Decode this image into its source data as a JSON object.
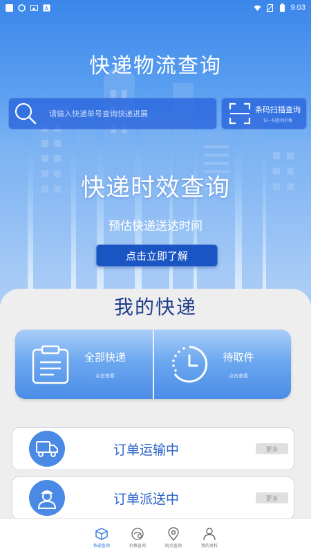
{
  "status_bar": {
    "time": "9:03"
  },
  "header": {
    "title": "快递物流查询"
  },
  "search": {
    "placeholder": "请输入快递单号查询快递进展"
  },
  "scan": {
    "label": "条码扫描查询",
    "sub": "扫一扫查询价格"
  },
  "banner": {
    "title": "快递时效查询",
    "subtitle": "预估快递送达时间",
    "button": "点击立即了解"
  },
  "my_express": {
    "title": "我的快递",
    "tiles": [
      {
        "label": "全部快递",
        "sub": "点击查看",
        "icon": "clipboard-icon"
      },
      {
        "label": "待取件",
        "sub": "点击查看",
        "icon": "clock-icon"
      }
    ],
    "orders": [
      {
        "label": "订单运输中",
        "more": "更多",
        "icon": "truck-icon"
      },
      {
        "label": "订单派送中",
        "more": "更多",
        "icon": "courier-icon"
      }
    ]
  },
  "nav": {
    "items": [
      {
        "label": "快递查询",
        "icon": "package-icon",
        "active": true
      },
      {
        "label": "价格查询",
        "icon": "price-search-icon",
        "active": false
      },
      {
        "label": "网点查询",
        "icon": "location-icon",
        "active": false
      },
      {
        "label": "我的资料",
        "icon": "profile-icon",
        "active": false
      }
    ]
  },
  "colors": {
    "primary": "#3b86ea",
    "title_dark": "#1e3c8c",
    "button_dark": "#1a55c4"
  }
}
